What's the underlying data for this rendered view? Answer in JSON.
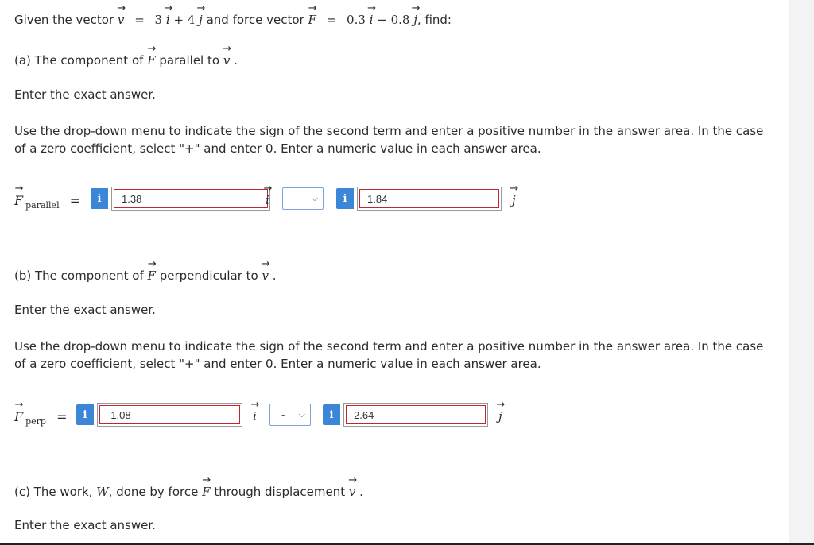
{
  "problem": {
    "intro_prefix": "Given the vector",
    "v_symbol": "v",
    "eq": "=",
    "v_expr": [
      "3",
      "i",
      "+ 4",
      "j"
    ],
    "and_text": "and force vector",
    "f_symbol": "F",
    "f_expr": [
      "0.3",
      "i",
      "− 0.8",
      "j"
    ],
    "suffix": ", find:"
  },
  "instructions": {
    "exact": "Enter the exact answer.",
    "dropdown": "Use the drop-down menu to indicate the sign of the second term and enter a positive number in the answer area. In the case of a zero coefficient, select \"+\" and enter 0. Enter a numeric value in each answer area."
  },
  "part_a": {
    "label": "(a) The component of",
    "middle": "parallel to",
    "end": ".",
    "lhs_sub": "parallel",
    "answer1": "1.38",
    "unit1": "i",
    "sign": "-",
    "answer2": "1.84",
    "unit2": "j"
  },
  "part_b": {
    "label": "(b) The component of",
    "middle": "perpendicular to",
    "end": ".",
    "lhs_sub": "perp",
    "answer1": "-1.08",
    "unit1": "i",
    "sign": "-",
    "answer2": "2.64",
    "unit2": "j"
  },
  "part_c": {
    "label": "(c) The work,",
    "w_symbol": "W",
    "middle": ", done by force",
    "middle2": "through displacement",
    "end": "."
  },
  "info_icon_glyph": "i",
  "colors": {
    "info_button": "#3b86d6",
    "answer_border": "#c0272d",
    "select_border": "#7aa4d8"
  }
}
